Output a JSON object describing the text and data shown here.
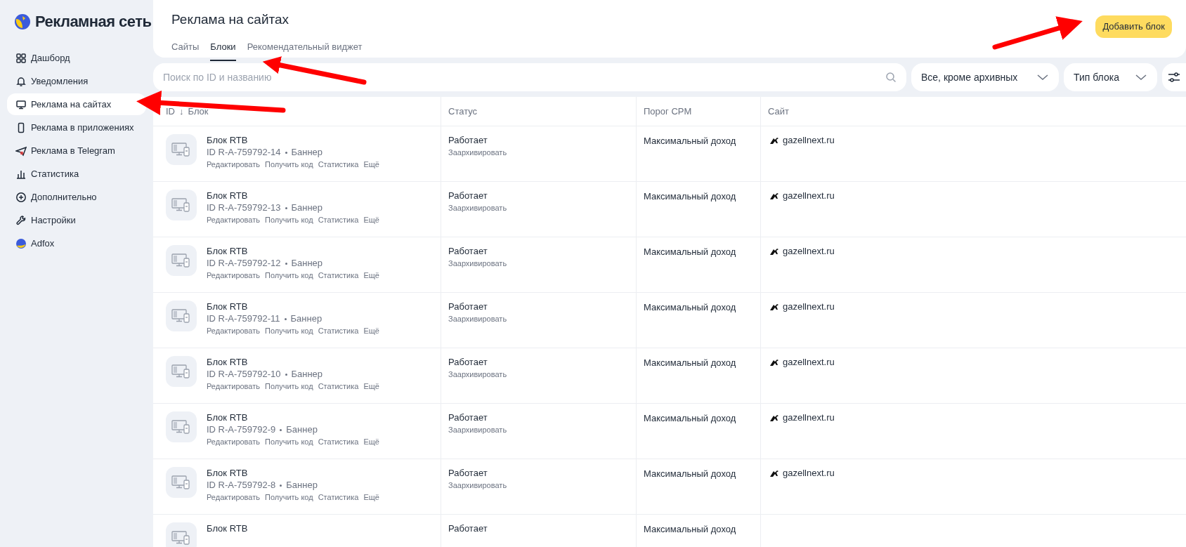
{
  "logo": {
    "text": "Рекламная сеть"
  },
  "sidebar": {
    "items": [
      {
        "label": "Дашборд",
        "selected": false
      },
      {
        "label": "Уведомления",
        "selected": false
      },
      {
        "label": "Реклама на сайтах",
        "selected": true
      },
      {
        "label": "Реклама в приложениях",
        "selected": false
      },
      {
        "label": "Реклама в Telegram",
        "selected": false
      },
      {
        "label": "Статистика",
        "selected": false
      },
      {
        "label": "Дополнительно",
        "selected": false
      },
      {
        "label": "Настройки",
        "selected": false
      },
      {
        "label": "Adfox",
        "selected": false
      }
    ]
  },
  "header": {
    "title": "Реклама на сайтах",
    "button": "Добавить блок",
    "tabs": [
      {
        "label": "Сайты",
        "selected": false
      },
      {
        "label": "Блоки",
        "selected": true
      },
      {
        "label": "Рекомендательный виджет",
        "selected": false
      }
    ]
  },
  "filters": {
    "search": {
      "placeholder": "Поиск по ID и названию"
    },
    "status_select": "Все, кроме архивных",
    "type_select": "Тип блока"
  },
  "table": {
    "columns": [
      {
        "label": "ID",
        "sort": "↓"
      },
      {
        "label": "Блок"
      },
      {
        "label": "Статус"
      },
      {
        "label": "Порог CPM"
      },
      {
        "label": "Сайт"
      }
    ],
    "rows": [
      {
        "title": "Блок RTB",
        "id": "ID R-A-759792-14",
        "format": "Баннер",
        "actions": [
          "Редактировать",
          "Получить код",
          "Статистика",
          "Ещё"
        ],
        "status": "Работает",
        "status_action": "Заархивировать",
        "cpm": "Максимальный доход",
        "site": "gazellnext.ru"
      },
      {
        "title": "Блок RTB",
        "id": "ID R-A-759792-13",
        "format": "Баннер",
        "actions": [
          "Редактировать",
          "Получить код",
          "Статистика",
          "Ещё"
        ],
        "status": "Работает",
        "status_action": "Заархивировать",
        "cpm": "Максимальный доход",
        "site": "gazellnext.ru"
      },
      {
        "title": "Блок RTB",
        "id": "ID R-A-759792-12",
        "format": "Баннер",
        "actions": [
          "Редактировать",
          "Получить код",
          "Статистика",
          "Ещё"
        ],
        "status": "Работает",
        "status_action": "Заархивировать",
        "cpm": "Максимальный доход",
        "site": "gazellnext.ru"
      },
      {
        "title": "Блок RTB",
        "id": "ID R-A-759792-11",
        "format": "Баннер",
        "actions": [
          "Редактировать",
          "Получить код",
          "Статистика",
          "Ещё"
        ],
        "status": "Работает",
        "status_action": "Заархивировать",
        "cpm": "Максимальный доход",
        "site": "gazellnext.ru"
      },
      {
        "title": "Блок RTB",
        "id": "ID R-A-759792-10",
        "format": "Баннер",
        "actions": [
          "Редактировать",
          "Получить код",
          "Статистика",
          "Ещё"
        ],
        "status": "Работает",
        "status_action": "Заархивировать",
        "cpm": "Максимальный доход",
        "site": "gazellnext.ru"
      },
      {
        "title": "Блок RTB",
        "id": "ID R-A-759792-9",
        "format": "Баннер",
        "actions": [
          "Редактировать",
          "Получить код",
          "Статистика",
          "Ещё"
        ],
        "status": "Работает",
        "status_action": "Заархивировать",
        "cpm": "Максимальный доход",
        "site": "gazellnext.ru"
      },
      {
        "title": "Блок RTB",
        "id": "ID R-A-759792-8",
        "format": "Баннер",
        "actions": [
          "Редактировать",
          "Получить код",
          "Статистика",
          "Ещё"
        ],
        "status": "Работает",
        "status_action": "Заархивировать",
        "cpm": "Максимальный доход",
        "site": "gazellnext.ru"
      },
      {
        "title": "Блок RTB",
        "status": "Работает",
        "cpm": "Максимальный доход"
      }
    ]
  }
}
